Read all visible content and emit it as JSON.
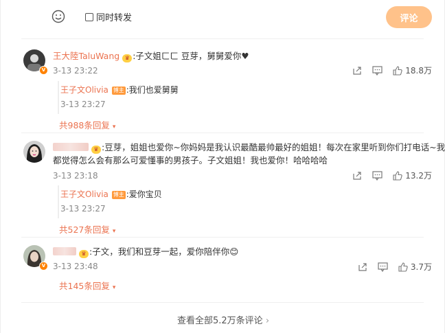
{
  "composer": {
    "emoji_icon": "smile-icon",
    "repost_label": "同时转发",
    "submit_label": "评论",
    "submit_color": "#ffc28a"
  },
  "comments": [
    {
      "username": "王大陸TaluWang",
      "vip_icon": "vip-crown-icon",
      "text": ":子文姐ㄈㄈ 豆芽，舅舅爱你♥",
      "time": "3-13 23:22",
      "likes": "18.8万",
      "reply": {
        "username": "王子文Olivia",
        "badge": "博主",
        "text": ":我们也爱舅舅",
        "time": "3-13 23:27"
      },
      "more_replies": "共988条回复"
    },
    {
      "username": "",
      "vip_icon": "vip-crown-icon",
      "text_line1": ":豆芽，姐姐也爱你~你妈妈是我认识最酷最帅最好的姐姐！每次在家里听到你们打电话~我",
      "text_line2": "都觉得怎么会有那么可爱懂事的男孩子。子文姐姐！我也爱你！哈哈哈哈",
      "time": "3-13 23:18",
      "likes": "13.2万",
      "reply": {
        "username": "王子文Olivia",
        "badge": "博主",
        "text": ":爱你宝贝",
        "time": "3-13 23:27"
      },
      "more_replies": "共527条回复"
    },
    {
      "username": "",
      "vip_icon": "vip-crown-icon",
      "text": ":子文，我们和豆芽一起，爱你陪伴你😊",
      "time": "3-13 23:48",
      "likes": "3.7万",
      "more_replies": "共145条回复"
    }
  ],
  "footer": {
    "view_all": "查看全部5.2万条评论"
  },
  "colors": {
    "username": "#eb7350",
    "accent": "#ff8200"
  }
}
